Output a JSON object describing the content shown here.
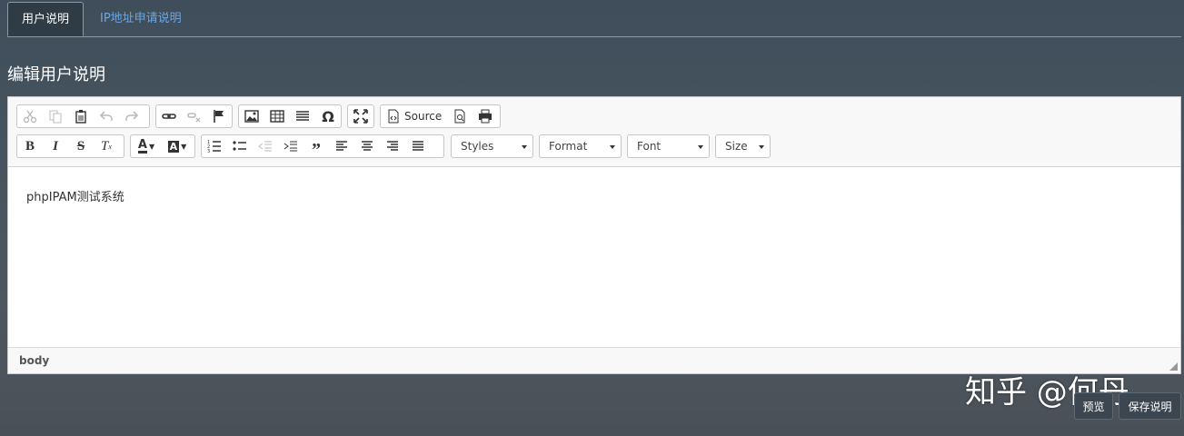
{
  "tabs": [
    {
      "label": "用户说明",
      "active": true
    },
    {
      "label": "IP地址申请说明",
      "active": false
    }
  ],
  "page_title": "编辑用户说明",
  "toolbar": {
    "row1": {
      "clipboard": [
        "cut-icon",
        "copy-icon",
        "paste-icon",
        "undo-icon",
        "redo-icon"
      ],
      "links": [
        "link-icon",
        "unlink-icon",
        "anchor-flag-icon"
      ],
      "insert": [
        "image-icon",
        "table-icon",
        "horizontal-rule-icon",
        "special-char-icon"
      ],
      "maximize": "maximize-icon",
      "source_label": "Source",
      "doc_tools": [
        "preview-icon",
        "print-icon"
      ]
    },
    "row2": {
      "format": [
        "bold-icon",
        "italic-icon",
        "strike-icon",
        "remove-format-icon"
      ],
      "colors": [
        "text-color-icon",
        "bg-color-icon"
      ],
      "lists": [
        "numbered-list-icon",
        "bulleted-list-icon",
        "outdent-icon",
        "indent-icon",
        "blockquote-icon",
        "align-left-icon",
        "align-center-icon",
        "align-right-icon",
        "justify-icon"
      ],
      "styles_label": "Styles",
      "format_label": "Format",
      "font_label": "Font",
      "size_label": "Size"
    }
  },
  "content": {
    "text": "phpIPAM测试系统"
  },
  "statusbar": {
    "path": "body"
  },
  "watermark": "知乎 @何丹",
  "buttons": {
    "preview": "预览",
    "save": "保存说明"
  },
  "colors": {
    "link": "#6aa7e6",
    "bg": "#46545f"
  }
}
